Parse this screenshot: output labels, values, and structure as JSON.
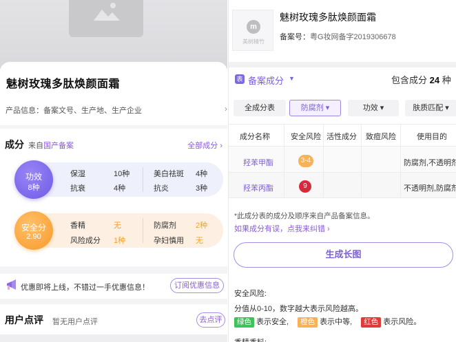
{
  "left": {
    "product_name": "魅树玫瑰多肽焕颜面霜",
    "info_row": "产品信息：备案文号、生产地、生产企业",
    "ingredients": {
      "title": "成分",
      "source_prefix": "来自",
      "source_highlight": "国产备案",
      "all_link": "全部成分 ›",
      "effect": {
        "label": "功效",
        "count": "8种",
        "items": [
          {
            "name": "保湿",
            "value": "10种"
          },
          {
            "name": "美白祛斑",
            "value": "4种"
          },
          {
            "name": "抗衰",
            "value": "4种"
          },
          {
            "name": "抗炎",
            "value": "3种"
          }
        ]
      },
      "safety": {
        "label": "安全分",
        "score": "2.90",
        "items": [
          {
            "name": "香精",
            "value": "无"
          },
          {
            "name": "防腐剂",
            "value": "2种"
          },
          {
            "name": "风险成分",
            "value": "1种"
          },
          {
            "name": "孕妇慎用",
            "value": "无"
          }
        ]
      }
    },
    "promo": {
      "text": "优惠即将上线，不错过一手优惠信息！",
      "button": "订阅优惠信息"
    },
    "review": {
      "title": "用户点评",
      "subtitle": "暂无用户点评",
      "button": "去点评"
    }
  },
  "right": {
    "thumb_text": "美树精竹",
    "thumb_logo": "m",
    "product_name": "魅树玫瑰多肽焕颜面霜",
    "reg_label": "备案号：",
    "reg_value": "粤G妆网备字2019306678",
    "filed_badge": "表",
    "filed_title": "备案成分",
    "count_prefix": "包含成分",
    "count_value": "24",
    "count_unit": "种",
    "filters": [
      "全成分表",
      "防腐剂 ▾",
      "功效 ▾",
      "肤质匹配 ▾"
    ],
    "table": {
      "headers": [
        "成分名称",
        "安全风险",
        "活性成分",
        "致痘风险",
        "使用目的"
      ],
      "rows": [
        {
          "name": "羟苯甲酯",
          "risk": "3-4",
          "purpose": "防腐剂,不透明剂"
        },
        {
          "name": "羟苯丙酯",
          "risk": "9",
          "purpose": "不透明剂,防腐剂"
        }
      ]
    },
    "note": "*此成分表的成分及顺序来自产品备案信息。",
    "note_link": "如果成分有误，点我来纠错 ›",
    "generate_button": "生成长图",
    "safety_title": "安全风险:",
    "safety_desc": "分值从0-10，数字越大表示风险越高。",
    "legend": [
      {
        "chip": "绿色",
        "text": "表示安全,",
        "color": "#3ec25a"
      },
      {
        "chip": "橙色",
        "text": "表示中等,",
        "color": "#f5b25a"
      },
      {
        "chip": "红色",
        "text": "表示风险。",
        "color": "#e03b3b"
      }
    ],
    "more_title": "香精香料:"
  }
}
